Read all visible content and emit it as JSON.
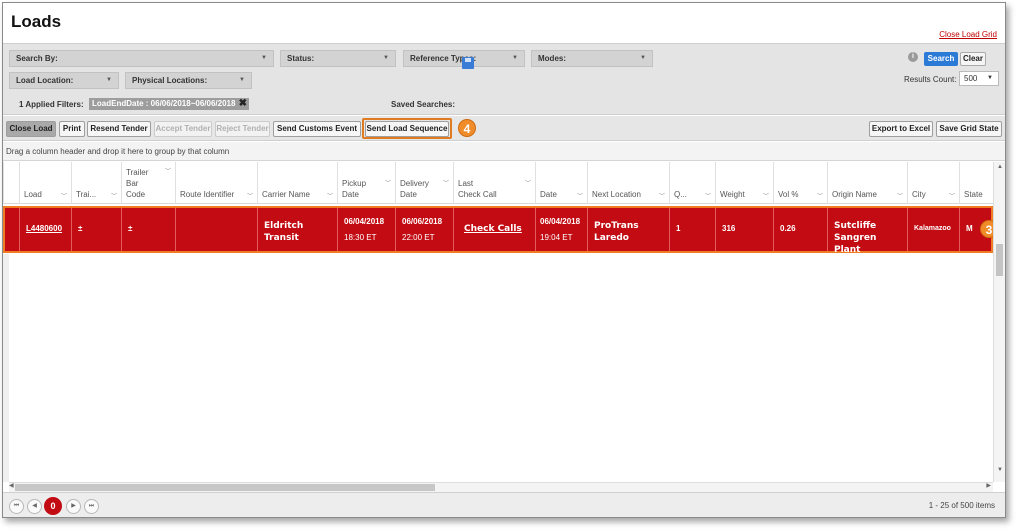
{
  "page": {
    "title": "Loads",
    "close_grid": "Close Load Grid"
  },
  "filters": {
    "search_by": "Search By:",
    "status": "Status:",
    "reference_types": "Reference Types:",
    "modes": "Modes:",
    "load_location": "Load Location:",
    "physical_locations": "Physical Locations:",
    "applied_filters": "1 Applied Filters:",
    "filter_chip": "LoadEndDate : 06/06/2018~06/06/2018",
    "saved_searches": "Saved Searches:",
    "search_btn": "Search",
    "clear_btn": "Clear",
    "results_count_label": "Results Count:",
    "results_count_value": "500"
  },
  "toolbar": {
    "close_load": "Close Load",
    "print": "Print",
    "resend_tender": "Resend Tender",
    "accept_tender": "Accept Tender",
    "reject_tender": "Reject Tender",
    "send_customs_event": "Send Customs Event",
    "send_load_sequence": "Send Load Sequence",
    "export_to_excel": "Export to Excel",
    "save_grid_state": "Save Grid State"
  },
  "badges": {
    "four": "4",
    "three": "3"
  },
  "grid": {
    "group_hint": "Drag a column header and drop it here to group by that column",
    "columns": [
      "Load",
      "Trai...",
      "Trailer Bar Code",
      "Route Identifier",
      "Carrier Name",
      "Pickup Date",
      "Delivery Date",
      "Last Check Call",
      "Date",
      "Next Location",
      "Q...",
      "Weight",
      "Vol %",
      "Origin Name",
      "City",
      "State"
    ],
    "row": {
      "load": "L4480600",
      "trailer": "±",
      "trailer_bar_code": "±",
      "route_identifier": "",
      "carrier_name": "Eldritch Transit",
      "pickup_date": "06/04/2018",
      "pickup_time": "18:30 ET",
      "delivery_date": "06/06/2018",
      "delivery_time": "22:00 ET",
      "last_check_call": "Check Calls",
      "date": "06/04/2018",
      "date_time": "19:04 ET",
      "next_location": "ProTrans Laredo",
      "quantity": "1",
      "weight": "316",
      "vol": "0.26",
      "origin_name": "Sutcliffe Sangren Plant",
      "city": "Kalamazoo",
      "state": "M"
    }
  },
  "pager": {
    "current": "0",
    "info": "1 - 25 of 500 items"
  },
  "colors": {
    "accent_red": "#c20b12",
    "highlight_orange": "#f07d25",
    "search_blue": "#2a7ad6"
  }
}
